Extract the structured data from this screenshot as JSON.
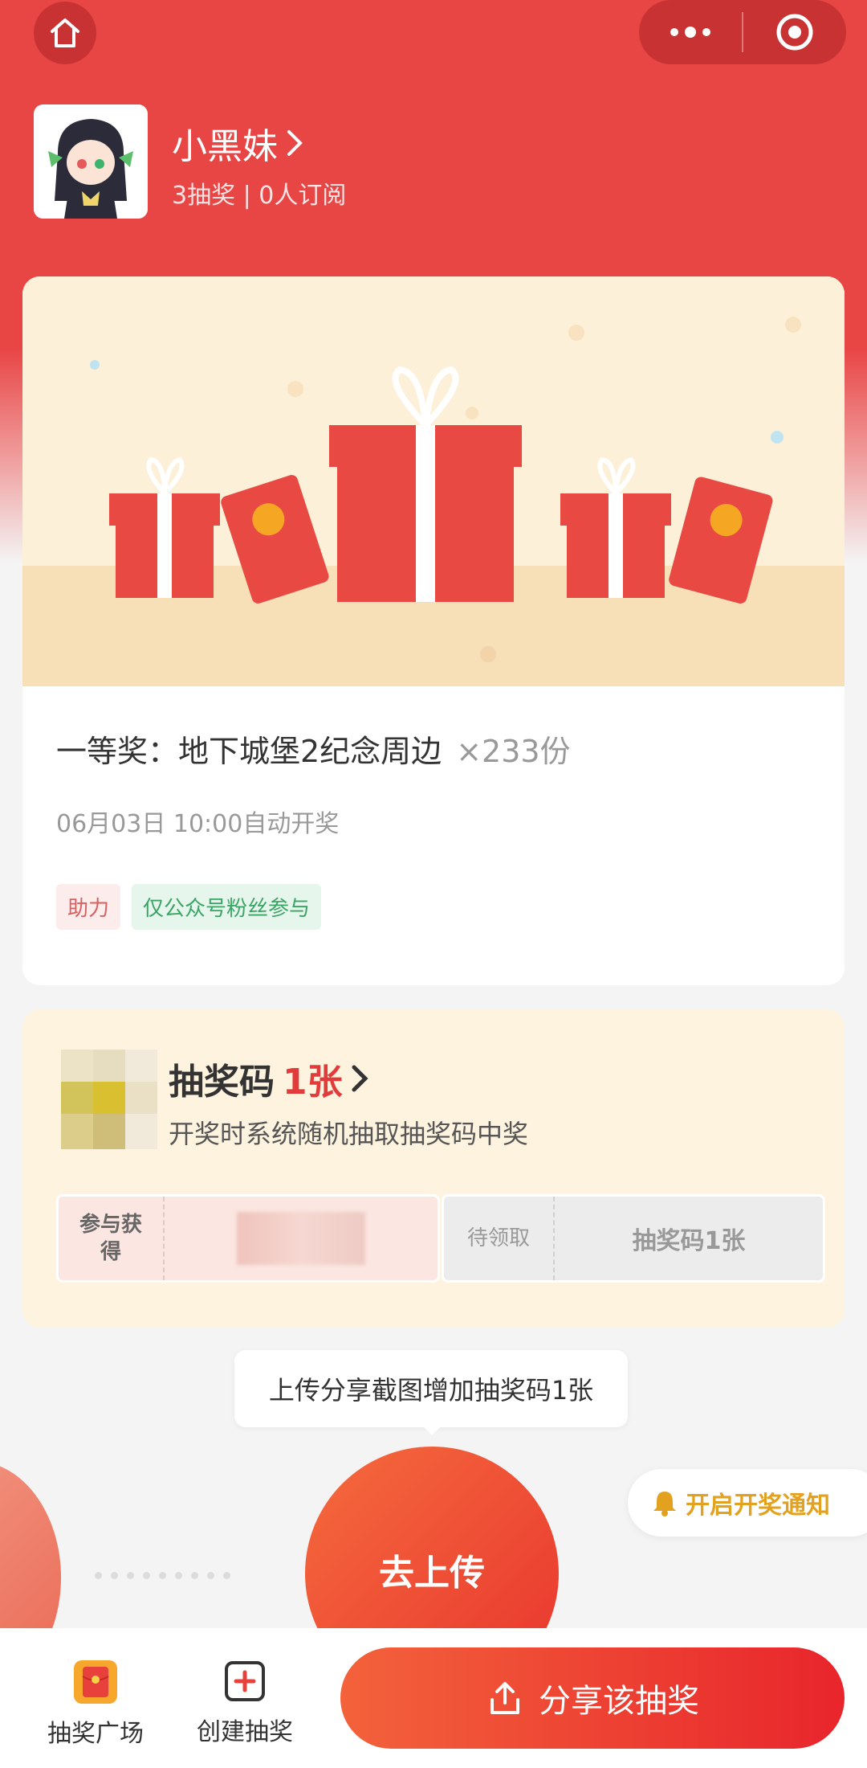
{
  "topbar": {
    "home_icon": "home-icon",
    "more_icon": "more-dots-icon",
    "close_icon": "target-close-icon"
  },
  "profile": {
    "name": "小黑妹",
    "stats": "3抽奖 | 0人订阅"
  },
  "prize": {
    "title": "一等奖：地下城堡2纪念周边",
    "quantity": "×233份",
    "draw_time": "06月03日 10:00自动开奖",
    "tags": [
      "助力",
      "仅公众号粉丝参与"
    ]
  },
  "lottery_code": {
    "title": "抽奖码",
    "count": "1张",
    "subtitle": "开奖时系统随机抽取抽奖码中奖",
    "ticket_left_label": "参与获得",
    "ticket_right_label": "待领取",
    "ticket_right_value": "抽奖码1张"
  },
  "tooltip": "上传分享截图增加抽奖码1张",
  "upload_button": "去上传",
  "notify_button": "开启开奖通知",
  "bottom": {
    "tab1": "抽奖广场",
    "tab2": "创建抽奖",
    "share": "分享该抽奖"
  },
  "colors": {
    "brand_red": "#e84545",
    "accent_gold": "#e2a21f"
  }
}
